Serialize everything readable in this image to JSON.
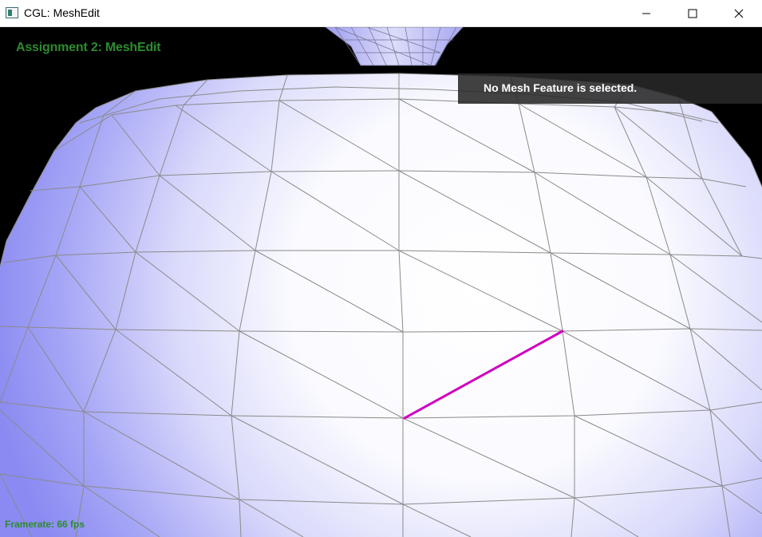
{
  "window": {
    "title": "CGL: MeshEdit",
    "icon": "app-window-icon",
    "controls": [
      "minimize-icon",
      "maximize-icon",
      "close-icon"
    ]
  },
  "hud": {
    "title": "Assignment 2: MeshEdit",
    "selection_status": "No Mesh Feature is selected.",
    "framerate": "Framerate: 66 fps"
  },
  "colors": {
    "hud_text": "#2e8b2e",
    "selected_edge": "#d000c0",
    "mesh_wire": "#8a8a8a",
    "mesh_shade": "#8e8ef8",
    "background": "#000000"
  }
}
